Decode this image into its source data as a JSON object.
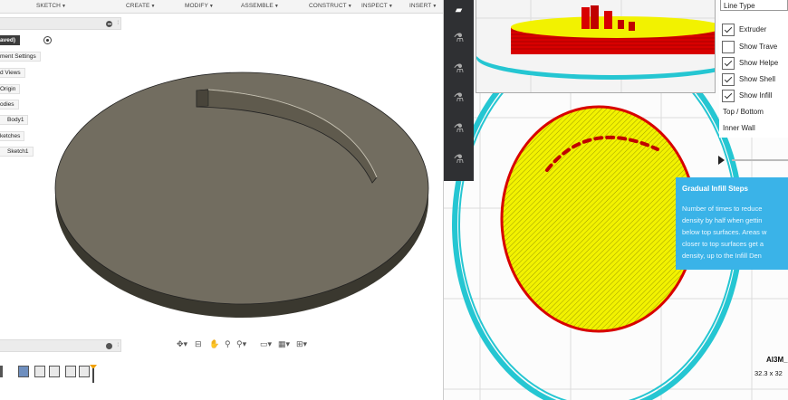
{
  "cad": {
    "toolbar": {
      "sketch": "SKETCH",
      "create": "CREATE",
      "modify": "MODIFY",
      "assemble": "ASSEMBLE",
      "construct": "CONSTRUCT",
      "inspect": "INSPECT",
      "insert": "INSERT",
      "caret": "▼"
    },
    "browser": {
      "root_label": "aved)",
      "items": [
        "ment Settings",
        "d Views",
        "Origin",
        "odies",
        "Body1",
        "ketches",
        "Sketch1"
      ]
    },
    "nav_icons": [
      "orbit-icon",
      "look-at-icon",
      "pan-icon",
      "zoom-icon",
      "fit-icon",
      "display-icon",
      "grid-icon",
      "viewports-icon"
    ],
    "timeline_icons": [
      "sketch-icon",
      "extrude-icon",
      "extrude-icon",
      "fillet-icon",
      "fillet-icon"
    ]
  },
  "slicer": {
    "line_type_label": "Line Type",
    "options": [
      {
        "label": "Extruder",
        "checked": true
      },
      {
        "label": "Show Trave",
        "checked": false
      },
      {
        "label": "Show Helpe",
        "checked": true
      },
      {
        "label": "Show Shell",
        "checked": true
      },
      {
        "label": "Show Infill",
        "checked": true
      }
    ],
    "top_bottom_label": "Top / Bottom",
    "inner_wall_label": "Inner Wall",
    "tooltip": {
      "title": "Gradual Infill Steps",
      "body_lines": [
        "Number of times to reduce",
        "density by half when gettin",
        "below top surfaces. Areas w",
        "closer to top surfaces get a",
        "density, up to the Infill Den"
      ]
    },
    "model_name": "AI3M_",
    "model_dims": "32.3 x 32",
    "colors": {
      "shell": "#25c6d2",
      "infill": "#f2f200",
      "wall": "#d80000"
    }
  }
}
